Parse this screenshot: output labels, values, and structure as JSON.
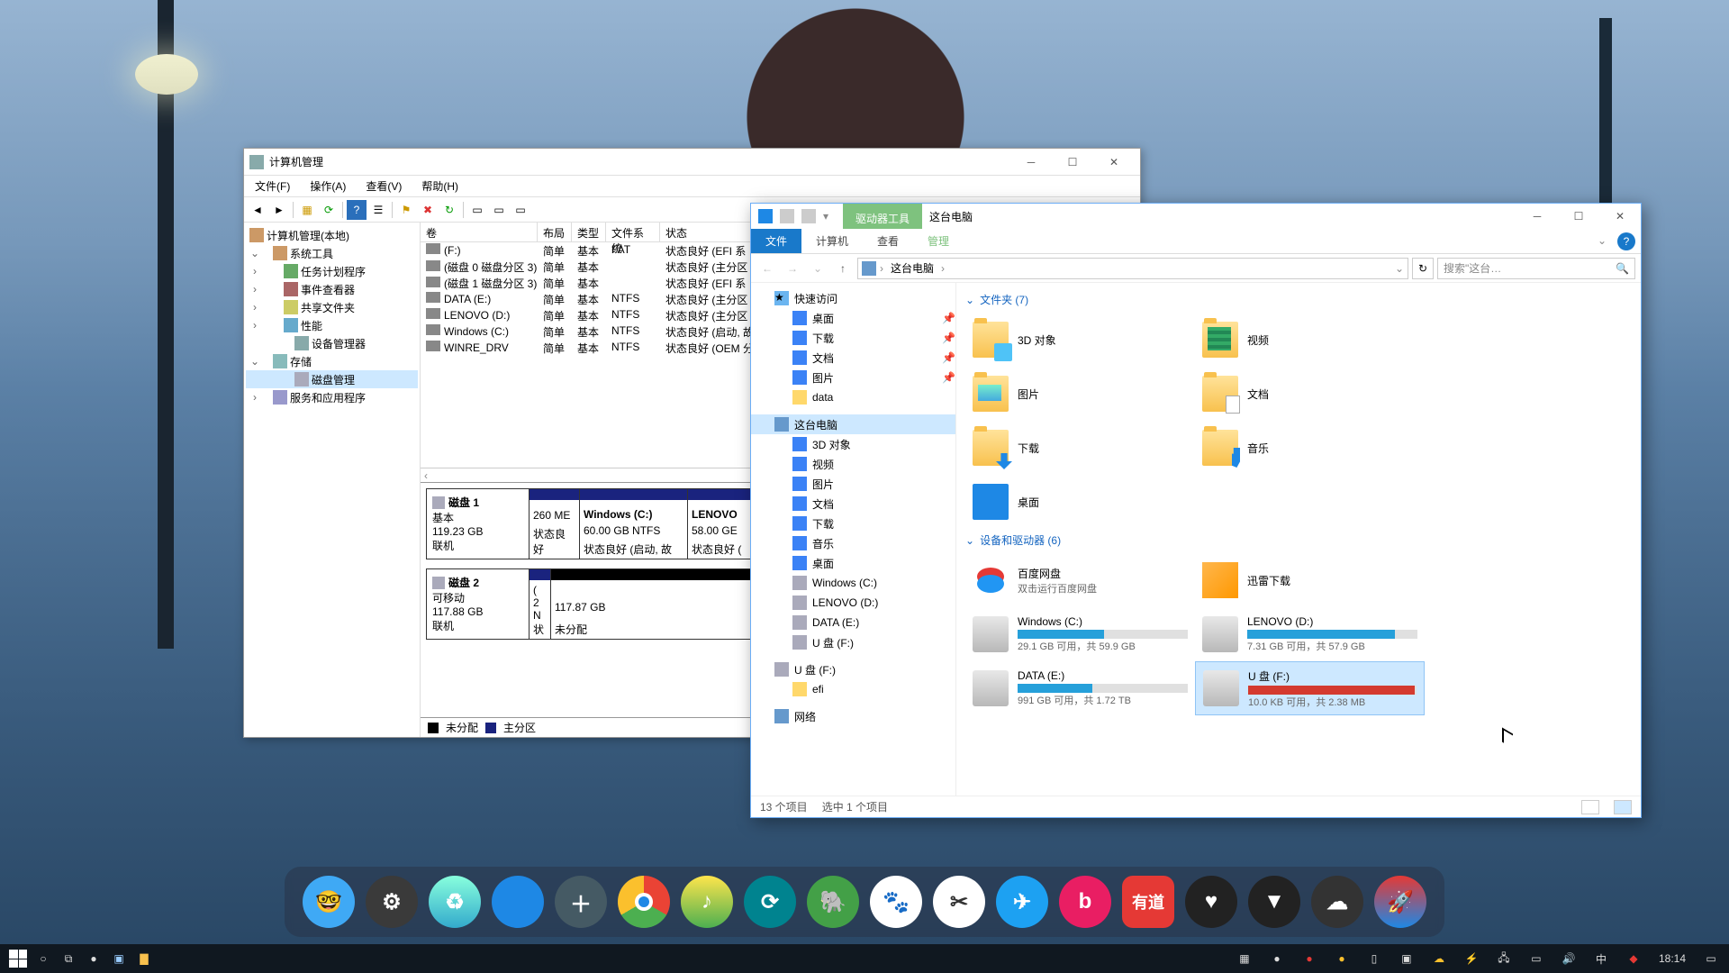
{
  "mgmt": {
    "title": "计算机管理",
    "menu": {
      "file": "文件(F)",
      "action": "操作(A)",
      "view": "查看(V)",
      "help": "帮助(H)"
    },
    "tree": {
      "root": "计算机管理(本地)",
      "system_tools": "系统工具",
      "task_scheduler": "任务计划程序",
      "event_viewer": "事件查看器",
      "shared_folders": "共享文件夹",
      "performance": "性能",
      "device_manager": "设备管理器",
      "storage": "存储",
      "disk_management": "磁盘管理",
      "services": "服务和应用程序"
    },
    "columns": {
      "vol": "卷",
      "layout": "布局",
      "type": "类型",
      "fs": "文件系统",
      "status": "状态"
    },
    "vols": [
      {
        "name": "(F:)",
        "layout": "简单",
        "type": "基本",
        "fs": "FAT",
        "status": "状态良好 (EFI 系"
      },
      {
        "name": "(磁盘 0 磁盘分区 3)",
        "layout": "简单",
        "type": "基本",
        "fs": "",
        "status": "状态良好 (主分区"
      },
      {
        "name": "(磁盘 1 磁盘分区 3)",
        "layout": "简单",
        "type": "基本",
        "fs": "",
        "status": "状态良好 (EFI 系"
      },
      {
        "name": "DATA (E:)",
        "layout": "简单",
        "type": "基本",
        "fs": "NTFS",
        "status": "状态良好 (主分区"
      },
      {
        "name": "LENOVO (D:)",
        "layout": "简单",
        "type": "基本",
        "fs": "NTFS",
        "status": "状态良好 (主分区"
      },
      {
        "name": "Windows (C:)",
        "layout": "简单",
        "type": "基本",
        "fs": "NTFS",
        "status": "状态良好 (启动, 故"
      },
      {
        "name": "WINRE_DRV",
        "layout": "简单",
        "type": "基本",
        "fs": "NTFS",
        "status": "状态良好 (OEM 分"
      }
    ],
    "disk1": {
      "label": "磁盘 1",
      "kind": "基本",
      "size": "119.23 GB",
      "state": "联机",
      "p1": {
        "size": "260 ME",
        "status": "状态良好"
      },
      "p2": {
        "name": "Windows  (C:)",
        "size": "60.00 GB NTFS",
        "status": "状态良好 (启动, 故"
      },
      "p3": {
        "name": "LENOVO",
        "size": "58.00 GE",
        "status": "状态良好 ("
      }
    },
    "disk2": {
      "label": "磁盘 2",
      "kind": "可移动",
      "size": "117.88 GB",
      "state": "联机",
      "p1": {
        "name": "(",
        "size": "2 N",
        "status": "状"
      },
      "p2": {
        "size": "117.87 GB",
        "status": "未分配"
      }
    },
    "legend": {
      "unalloc": "未分配",
      "primary": "主分区"
    }
  },
  "explorer": {
    "ctx_tab": "驱动器工具",
    "window_title": "这台电脑",
    "tabs": {
      "file": "文件",
      "computer": "计算机",
      "view": "查看",
      "manage": "管理"
    },
    "crumb": "这台电脑",
    "search_placeholder": "搜索\"这台…",
    "nav": {
      "quick": "快速访问",
      "desktop": "桌面",
      "downloads": "下载",
      "documents": "文档",
      "pictures": "图片",
      "data": "data",
      "thispc": "这台电脑",
      "obj3d": "3D 对象",
      "videos": "视频",
      "pictures2": "图片",
      "documents2": "文档",
      "downloads2": "下载",
      "music": "音乐",
      "desktop2": "桌面",
      "winc": "Windows (C:)",
      "lenovod": "LENOVO (D:)",
      "datae": "DATA (E:)",
      "usbf": "U 盘 (F:)",
      "usbf2": "U 盘 (F:)",
      "efi": "efi",
      "network": "网络"
    },
    "group_folders": "文件夹 (7)",
    "folders": {
      "obj3d": "3D 对象",
      "videos": "视频",
      "pictures": "图片",
      "documents": "文档",
      "downloads": "下载",
      "music": "音乐",
      "desktop": "桌面"
    },
    "group_drives": "设备和驱动器 (6)",
    "drives": {
      "baidu": {
        "name": "百度网盘",
        "sub": "双击运行百度网盘"
      },
      "xunlei": {
        "name": "迅雷下载"
      },
      "c": {
        "name": "Windows (C:)",
        "info": "29.1 GB 可用，共 59.9 GB",
        "pct": 51,
        "color": "#26a0da"
      },
      "d": {
        "name": "LENOVO (D:)",
        "info": "7.31 GB 可用，共 57.9 GB",
        "pct": 87,
        "color": "#26a0da"
      },
      "e": {
        "name": "DATA (E:)",
        "info": "991 GB 可用，共 1.72 TB",
        "pct": 44,
        "color": "#26a0da"
      },
      "f": {
        "name": "U 盘 (F:)",
        "info": "10.0 KB 可用，共 2.38 MB",
        "pct": 99,
        "color": "#d43a2f"
      }
    },
    "status": {
      "count": "13 个项目",
      "selected": "选中 1 个项目"
    }
  },
  "taskbar": {
    "time": "18:14",
    "ime": "中"
  }
}
